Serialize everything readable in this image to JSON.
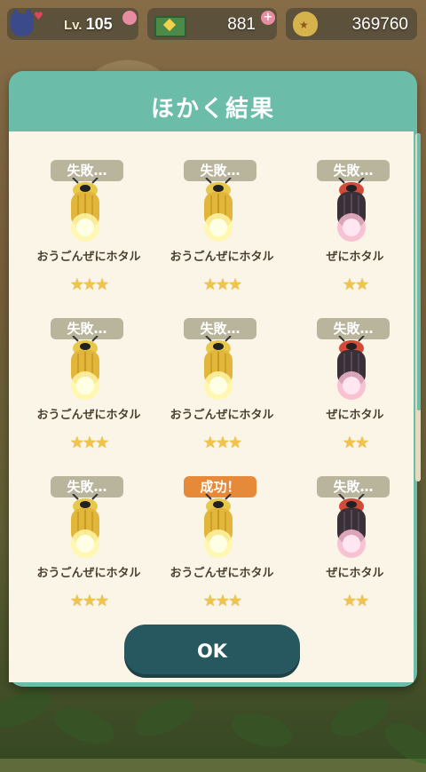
{
  "hud": {
    "level_label": "Lv.",
    "level_value": "105",
    "tickets": "881",
    "bells": "369760"
  },
  "dialog": {
    "title": "ほかく結果",
    "ok_label": "OK"
  },
  "results": [
    {
      "status": "失敗…",
      "success": false,
      "name": "おうごんぜにホタル",
      "stars": "★★★",
      "bug": "gold"
    },
    {
      "status": "失敗…",
      "success": false,
      "name": "おうごんぜにホタル",
      "stars": "★★★",
      "bug": "gold"
    },
    {
      "status": "失敗…",
      "success": false,
      "name": "ぜにホタル",
      "stars": "★★",
      "bug": "red"
    },
    {
      "status": "失敗…",
      "success": false,
      "name": "おうごんぜにホタル",
      "stars": "★★★",
      "bug": "gold"
    },
    {
      "status": "失敗…",
      "success": false,
      "name": "おうごんぜにホタル",
      "stars": "★★★",
      "bug": "gold"
    },
    {
      "status": "失敗…",
      "success": false,
      "name": "ぜにホタル",
      "stars": "★★",
      "bug": "red"
    },
    {
      "status": "失敗…",
      "success": false,
      "name": "おうごんぜにホタル",
      "stars": "★★★",
      "bug": "gold"
    },
    {
      "status": "成功！",
      "success": true,
      "name": "おうごんぜにホタル",
      "stars": "★★★",
      "bug": "gold"
    },
    {
      "status": "失敗…",
      "success": false,
      "name": "ぜにホタル",
      "stars": "★★",
      "bug": "red"
    }
  ]
}
